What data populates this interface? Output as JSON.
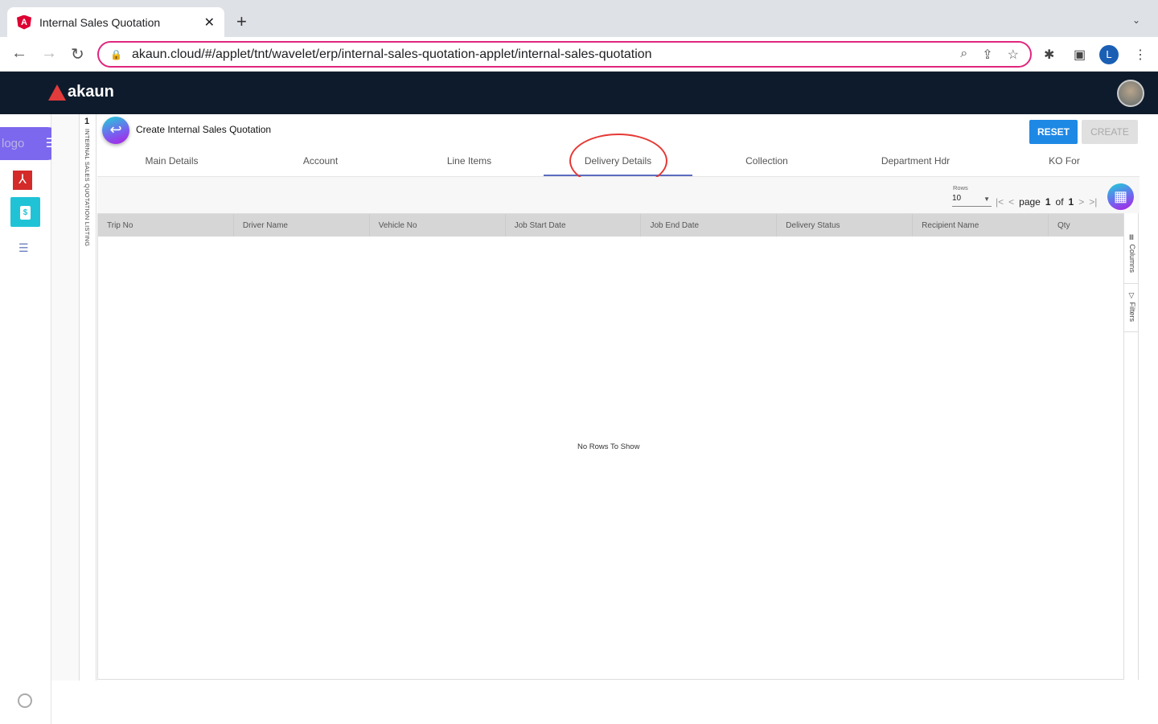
{
  "browser": {
    "tab_title": "Internal Sales Quotation",
    "url": "akaun.cloud/#/applet/tnt/wavelet/erp/internal-sales-quotation-applet/internal-sales-quotation",
    "profile_initial": "L"
  },
  "app": {
    "brand": "akaun",
    "logo_alt": "logo"
  },
  "strip": {
    "number": "1",
    "label": "INTERNAL SALES QUOTATION LISTING"
  },
  "page": {
    "title": "Create Internal Sales Quotation",
    "reset": "RESET",
    "create": "CREATE"
  },
  "tabs": [
    {
      "label": "Main Details"
    },
    {
      "label": "Account"
    },
    {
      "label": "Line Items"
    },
    {
      "label": "Delivery Details"
    },
    {
      "label": "Collection"
    },
    {
      "label": "Department Hdr"
    },
    {
      "label": "KO For"
    }
  ],
  "pager": {
    "rows_label": "Rows",
    "rows_value": "10",
    "page_word": "page",
    "page": "1",
    "of_word": "of",
    "total": "1"
  },
  "grid": {
    "columns": [
      "Trip No",
      "Driver Name",
      "Vehicle No",
      "Job Start Date",
      "Job End Date",
      "Delivery Status",
      "Recipient Name",
      "Qty"
    ],
    "empty": "No Rows To Show",
    "side_columns": "Columns",
    "side_filters": "Filters"
  },
  "colors": {
    "accent": "#1e88e5",
    "header": "#0e1b2c",
    "highlight": "#e53935"
  }
}
